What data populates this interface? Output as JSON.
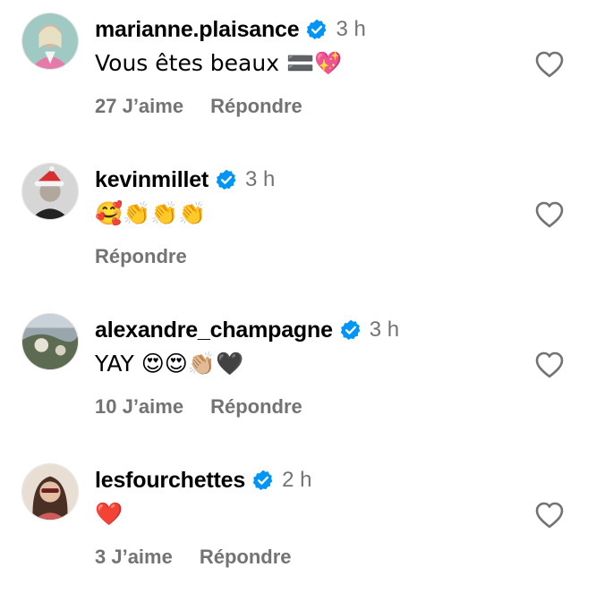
{
  "comments": [
    {
      "username": "marianne.plaisance",
      "time": "3 h",
      "text": "Vous êtes beaux 🟰💖",
      "likes": "27 J’aime",
      "reply": "Répondre"
    },
    {
      "username": "kevinmillet",
      "time": "3 h",
      "text": "🥰👏👏👏",
      "likes": "",
      "reply": "Répondre"
    },
    {
      "username": "alexandre_champagne",
      "time": "3 h",
      "text": "YAY 😍😍👏🏼🖤",
      "likes": "10 J’aime",
      "reply": "Répondre"
    },
    {
      "username": "lesfourchettes",
      "time": "2 h",
      "text": "❤️",
      "likes": "3 J’aime",
      "reply": "Répondre"
    }
  ],
  "colors": {
    "verified": "#0095f6",
    "meta": "#737373",
    "heart_outline": "#737373"
  },
  "icons": {
    "verified": "verified-badge-icon",
    "like": "heart-outline-icon"
  }
}
